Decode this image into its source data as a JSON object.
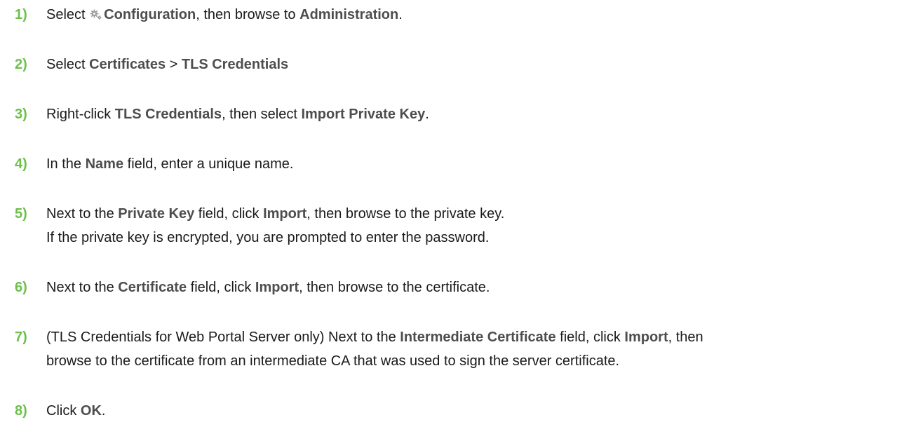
{
  "steps": [
    {
      "number": "1)",
      "parts": {
        "t1": "Select ",
        "icon": "gear-icon",
        "b1": "Configuration",
        "t2": ", then browse to ",
        "b2": "Administration",
        "t3": "."
      }
    },
    {
      "number": "2)",
      "parts": {
        "t1": "Select ",
        "b1": "Certificates",
        "t2": " > ",
        "b2": "TLS Credentials"
      }
    },
    {
      "number": "3)",
      "parts": {
        "t1": "Right-click ",
        "b1": "TLS Credentials",
        "t2": ", then select ",
        "b2": "Import Private Key",
        "t3": "."
      }
    },
    {
      "number": "4)",
      "parts": {
        "t1": "In the ",
        "b1": "Name",
        "t2": " field, enter a unique name."
      }
    },
    {
      "number": "5)",
      "parts": {
        "t1": "Next to the ",
        "b1": "Private Key",
        "t2": " field, click ",
        "b2": "Import",
        "t3": ", then browse to the private key.",
        "line2": "If the private key is encrypted, you are prompted to enter the password."
      }
    },
    {
      "number": "6)",
      "parts": {
        "t1": "Next to the ",
        "b1": "Certificate",
        "t2": " field, click ",
        "b2": "Import",
        "t3": ", then browse to the certificate."
      }
    },
    {
      "number": "7)",
      "parts": {
        "t1": "(TLS Credentials for Web Portal Server only) Next to the ",
        "b1": "Intermediate Certificate",
        "t2": " field, click ",
        "b2": "Import",
        "t3": ", then",
        "line2": "browse to the certificate from an intermediate CA that was used to sign the server certificate."
      }
    },
    {
      "number": "8)",
      "parts": {
        "t1": "Click ",
        "b1": "OK",
        "t2": "."
      }
    }
  ],
  "colors": {
    "step_number": "#6cc04a",
    "emphasis": "#4d4d4d",
    "body_text": "#1a1a1a",
    "icon": "#9a9a9a"
  }
}
